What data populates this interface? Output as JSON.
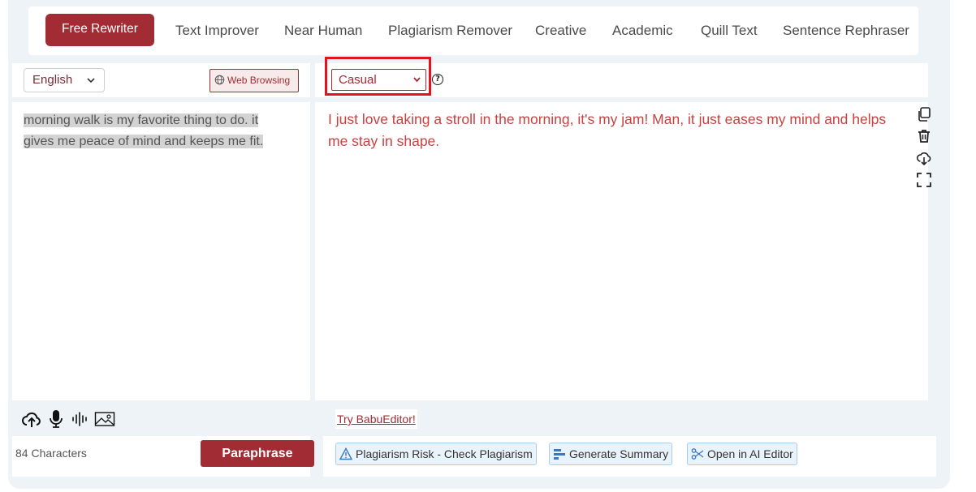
{
  "tabs": [
    {
      "label": "Free Rewriter",
      "active": true
    },
    {
      "label": "Text Improver"
    },
    {
      "label": "Near Human"
    },
    {
      "label": "Plagiarism Remover"
    },
    {
      "label": "Creative"
    },
    {
      "label": "Academic"
    },
    {
      "label": "Quill Text"
    },
    {
      "label": "Sentence Rephraser"
    }
  ],
  "left": {
    "language": "English",
    "web_browsing_label": "Web Browsing",
    "input_text": "morning walk is my favorite thing to do. it gives me peace of mind and keeps me fit.",
    "char_count": "84 Characters",
    "paraphrase_label": "Paraphrase"
  },
  "right": {
    "style_value": "Casual",
    "help_glyph": "?",
    "output_text": "I just love taking a stroll in the morning, it's my jam! Man, it just eases my mind and helps me stay in shape.",
    "try_label": "Try BabuEditor!",
    "actions": {
      "plagiarism": "Plagiarism Risk - Check Plagiarism",
      "summary": "Generate Summary",
      "ai_editor": "Open in AI Editor"
    }
  },
  "colors": {
    "accent": "#a12c33",
    "output": "#c9413f",
    "highlight_box": "#e0141d",
    "panel_bg": "#eef3f7"
  },
  "icons": [
    "copy-icon",
    "trash-icon",
    "download-cloud-icon",
    "fullscreen-icon",
    "upload-cloud-icon",
    "microphone-icon",
    "audio-wave-icon",
    "image-icon",
    "globe-icon",
    "warning-icon",
    "summary-icon",
    "ai-editor-icon"
  ]
}
